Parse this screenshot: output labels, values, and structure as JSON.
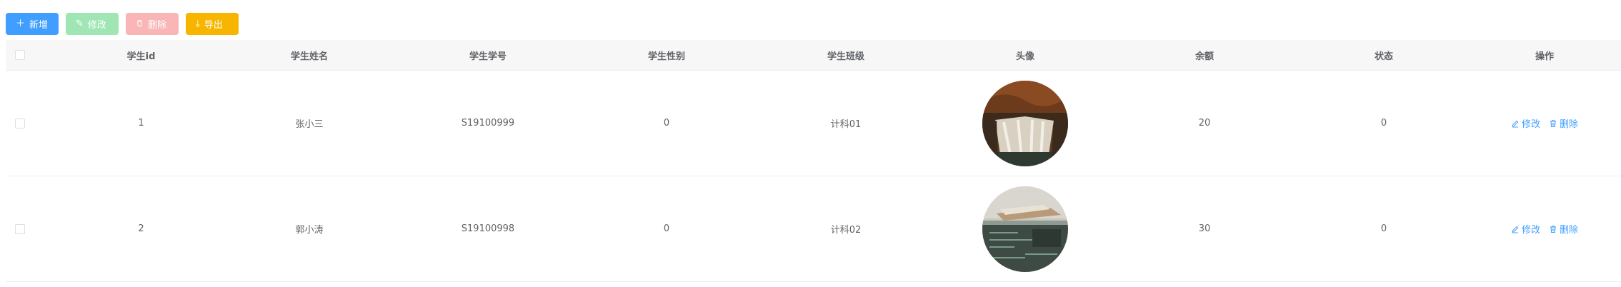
{
  "toolbar": {
    "add_label": "新增",
    "edit_label": "修改",
    "delete_label": "删除",
    "export_label": "导出"
  },
  "colors": {
    "primary": "#409eff",
    "success_disabled": "#a0e6b5",
    "danger_disabled": "#fab6b6",
    "warning": "#f7b500"
  },
  "table": {
    "headers": [
      "学生id",
      "学生姓名",
      "学生学号",
      "学生性别",
      "学生班级",
      "头像",
      "余额",
      "状态",
      "操作"
    ],
    "rows": [
      {
        "id": "1",
        "name": "张小三",
        "number": "S19100999",
        "gender": "0",
        "class": "计科01",
        "avatar": "waterfall-photo",
        "balance": "20",
        "status": "0",
        "edit_label": "修改",
        "delete_label": "删除"
      },
      {
        "id": "2",
        "name": "郭小涛",
        "number": "S19100998",
        "gender": "0",
        "class": "计科02",
        "avatar": "desk-photo",
        "balance": "30",
        "status": "0",
        "edit_label": "修改",
        "delete_label": "删除"
      }
    ]
  }
}
